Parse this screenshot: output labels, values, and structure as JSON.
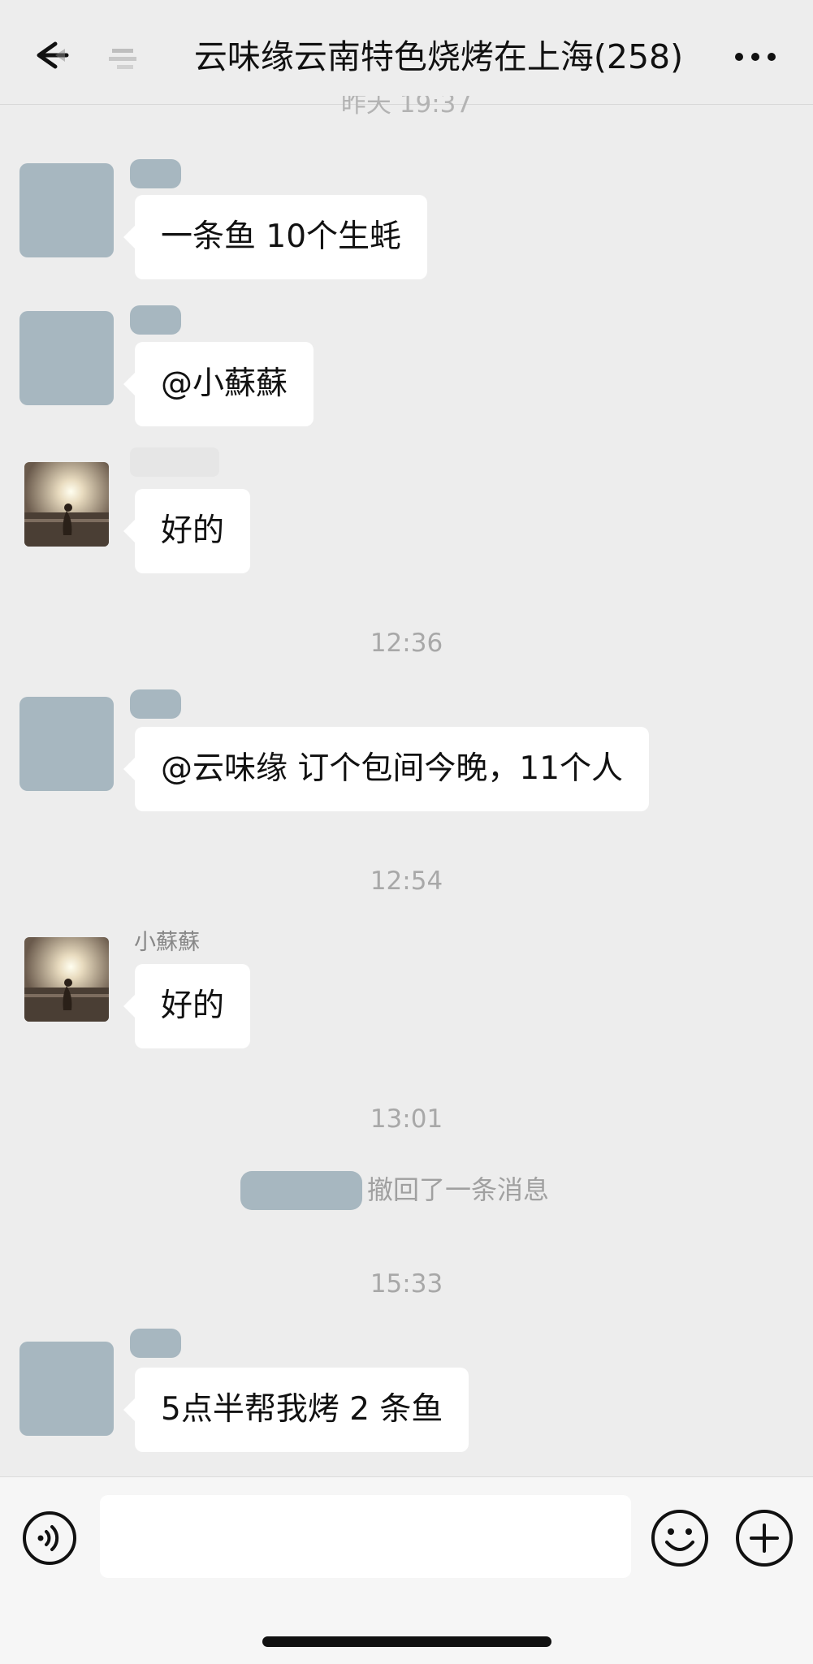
{
  "header": {
    "title": "云味缘云南特色烧烤在上海(258)",
    "back_icon": "back-arrow-icon",
    "more_icon": "more-dots-icon"
  },
  "partial_timestamp": "昨天 19:37",
  "messages": [
    {
      "text": "一条鱼 10个生蚝"
    },
    {
      "text": "@小蘇蘇"
    },
    {
      "text": "好的"
    },
    {
      "timestamp": "12:36"
    },
    {
      "text": "@云味缘 订个包间今晚，11个人"
    },
    {
      "timestamp": "12:54"
    },
    {
      "sender": "小蘇蘇",
      "text": "好的"
    },
    {
      "timestamp": "13:01"
    },
    {
      "system": "撤回了一条消息"
    },
    {
      "timestamp": "15:33"
    },
    {
      "text": "5点半帮我烤 2 条鱼"
    }
  ],
  "input": {
    "value": "",
    "voice_icon": "voice-icon",
    "emoji_icon": "emoji-icon",
    "plus_icon": "plus-icon"
  },
  "colors": {
    "background": "#ededed",
    "bubble": "#ffffff",
    "redaction": "#a7b7c0"
  }
}
